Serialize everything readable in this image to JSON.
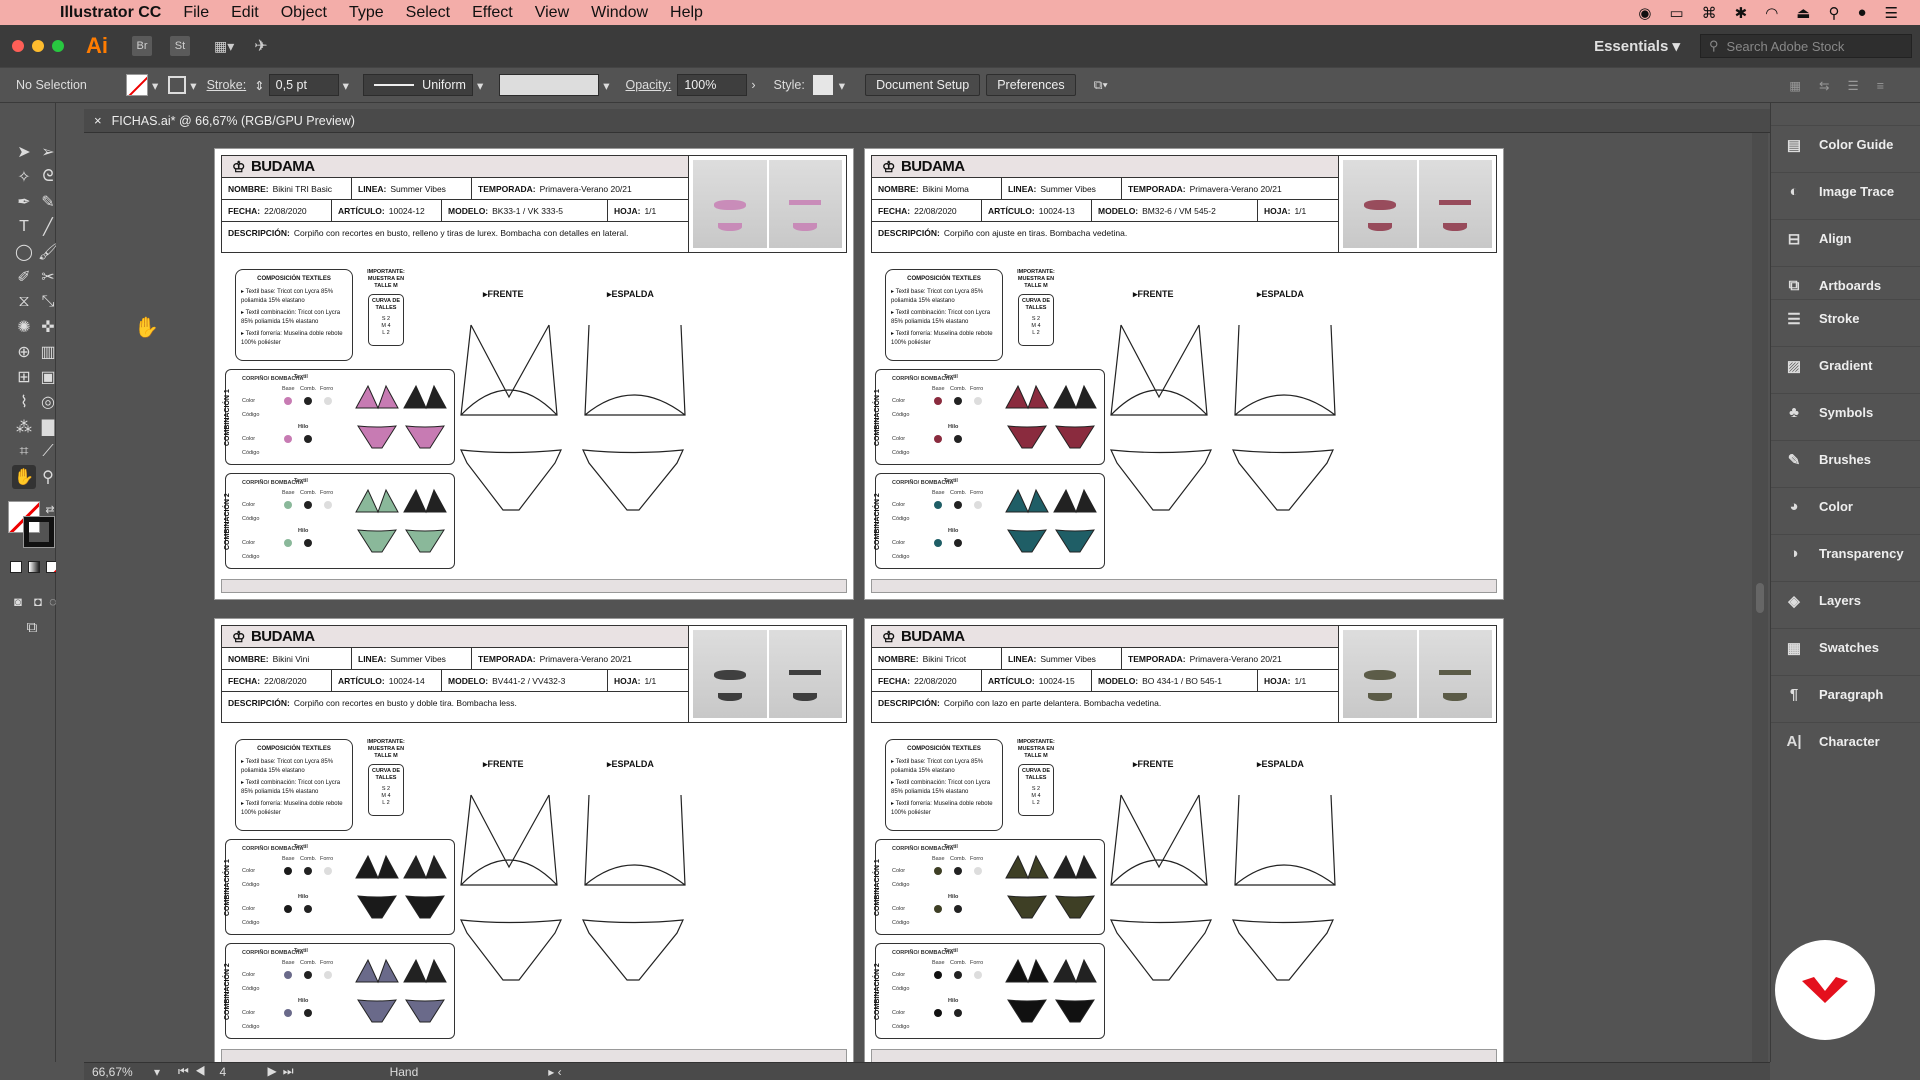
{
  "menubar": {
    "app_name": "Illustrator CC",
    "items": [
      "File",
      "Edit",
      "Object",
      "Type",
      "Select",
      "Effect",
      "View",
      "Window",
      "Help"
    ]
  },
  "appbar": {
    "logo": "Ai",
    "bridge": "Br",
    "stock_short": "St",
    "workspace": "Essentials",
    "search_placeholder": "Search Adobe Stock"
  },
  "control": {
    "selection": "No Selection",
    "stroke_label": "Stroke:",
    "stroke_value": "0,5 pt",
    "profile": "Uniform",
    "opacity_label": "Opacity:",
    "opacity_value": "100%",
    "style_label": "Style:",
    "document_setup": "Document Setup",
    "preferences": "Preferences"
  },
  "document": {
    "tab_title": "FICHAS.ai* @ 66,67% (RGB/GPU Preview)"
  },
  "labels": {
    "nombre": "NOMBRE:",
    "linea": "LINEA:",
    "temporada": "TEMPORADA:",
    "fecha": "FECHA:",
    "articulo": "ARTÍCULO:",
    "modelo": "MODELO:",
    "hoja": "HOJA:",
    "descripcion": "DESCRIPCIÓN:",
    "frente": "FRENTE",
    "espalda": "ESPALDA",
    "composicion": "COMPOSICIÓN TEXTILES",
    "importante": "IMPORTANTE: MUESTRA EN TALLE M",
    "curva": "CURVA DE TALLES",
    "combinacion1": "COMBINACIÓN 1",
    "combinacion2": "COMBINACIÓN 2",
    "corpino": "CORPIÑO/ BOMBACHA",
    "textil": "Textil",
    "base": "Base",
    "comb": "Comb.",
    "forro": "Forro",
    "color": "Color",
    "codigo": "Código",
    "hilo": "Hilo",
    "compo1": "Textil base: Tricot con Lycra 85% poliamida 15% elastano",
    "compo2": "Textil combinación: Tricot con Lycra 85% poliamida 15% elastano",
    "compo3": "Textil forrería: Muselina doble rebote 100% poliéster"
  },
  "artboards": [
    {
      "brand": "BUDAMA",
      "nombre": "Bikini TRI Basic",
      "linea": "Summer Vibes",
      "temporada": "Primavera-Verano 20/21",
      "fecha": "22/08/2020",
      "articulo": "10024-12",
      "modelo": "BK33-1 / VK 333-5",
      "hoja": "1/1",
      "descripcion": "Corpiño con recortes en busto, relleno y tiras de lurex. Bombacha con detalles en lateral.",
      "c1": "#c77bb3",
      "c2": "#8ab89a"
    },
    {
      "brand": "BUDAMA",
      "nombre": "Bikini Moma",
      "linea": "Summer Vibes",
      "temporada": "Primavera-Verano 20/21",
      "fecha": "22/08/2020",
      "articulo": "10024-13",
      "modelo": "BM32-6 / VM 545-2",
      "hoja": "1/1",
      "descripcion": "Corpiño con ajuste en tiras. Bombacha vedetina.",
      "c1": "#8a2b3e",
      "c2": "#1f5e66"
    },
    {
      "brand": "BUDAMA",
      "nombre": "Bikini Vini",
      "linea": "Summer Vibes",
      "temporada": "Primavera-Verano 20/21",
      "fecha": "22/08/2020",
      "articulo": "10024-14",
      "modelo": "BV441-2 / VV432-3",
      "hoja": "1/1",
      "descripcion": "Corpiño con recortes en busto y doble tira. Bombacha less.",
      "c1": "#1a1a1a",
      "c2": "#6a6a8a"
    },
    {
      "brand": "BUDAMA",
      "nombre": "Bikini Tricot",
      "linea": "Summer Vibes",
      "temporada": "Primavera-Verano 20/21",
      "fecha": "22/08/2020",
      "articulo": "10024-15",
      "modelo": "BO 434-1 / BO 545-1",
      "hoja": "1/1",
      "descripcion": "Corpiño con lazo en parte delantera. Bombacha vedetina.",
      "c1": "#3e3f25",
      "c2": "#111111"
    }
  ],
  "panels": [
    "Color Guide",
    "Image Trace",
    "Align",
    "Artboards",
    "Stroke",
    "Gradient",
    "Symbols",
    "Brushes",
    "Color",
    "Transparency",
    "Layers",
    "Swatches",
    "Paragraph",
    "Character"
  ],
  "status": {
    "zoom": "66,67%",
    "artboard_num": "4",
    "tool": "Hand"
  }
}
